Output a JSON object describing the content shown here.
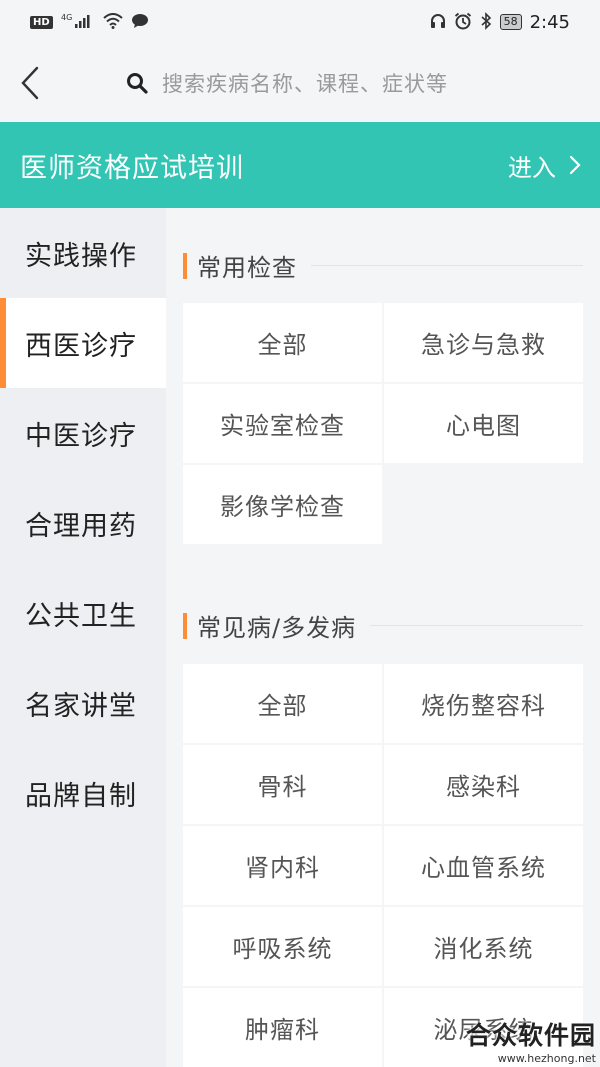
{
  "status_bar": {
    "hd_badge": "HD",
    "network": "4G",
    "battery": "58",
    "time": "2:45",
    "icons": [
      "signal-icon",
      "wifi-icon",
      "chat-bubble-icon",
      "headphones-icon",
      "alarm-icon",
      "bluetooth-icon"
    ]
  },
  "search": {
    "placeholder": "搜索疾病名称、课程、症状等",
    "back_icon": "chevron-left-icon",
    "search_icon": "search-icon"
  },
  "banner": {
    "title": "医师资格应试培训",
    "enter_label": "进入",
    "background_color": "#33c5b4"
  },
  "sidebar": {
    "accent_color": "#ff8c37",
    "active_index": 1,
    "items": [
      {
        "label": "实践操作"
      },
      {
        "label": "西医诊疗"
      },
      {
        "label": "中医诊疗"
      },
      {
        "label": "合理用药"
      },
      {
        "label": "公共卫生"
      },
      {
        "label": "名家讲堂"
      },
      {
        "label": "品牌自制"
      }
    ]
  },
  "sections": [
    {
      "title": "常用检查",
      "items": [
        "全部",
        "急诊与急救",
        "实验室检查",
        "心电图",
        "影像学检查"
      ]
    },
    {
      "title": "常见病/多发病",
      "items": [
        "全部",
        "烧伤整容科",
        "骨科",
        "感染科",
        "肾内科",
        "心血管系统",
        "呼吸系统",
        "消化系统",
        "肿瘤科",
        "泌尿系统"
      ]
    }
  ],
  "watermark": {
    "title": "合众软件园",
    "url": "www.hezhong.net"
  }
}
